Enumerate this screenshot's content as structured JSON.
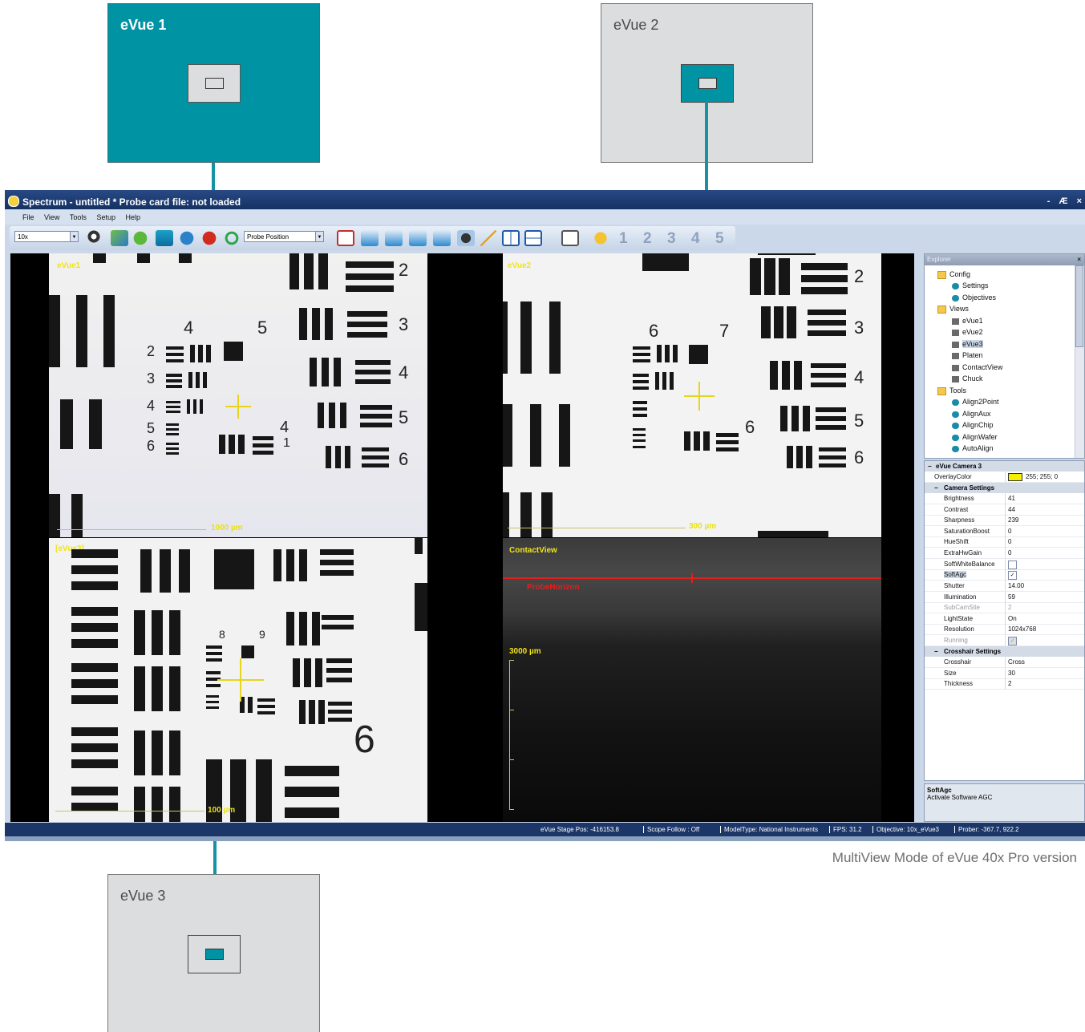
{
  "callouts": {
    "evue1": "eVue 1",
    "evue2": "eVue 2",
    "evue3": "eVue 3"
  },
  "caption": "MultiView Mode of eVue 40x Pro version",
  "app": {
    "title": "Spectrum - untitled *  Probe card file: not loaded",
    "window_controls": [
      "-",
      "Æ",
      "×"
    ],
    "menu": [
      "File",
      "View",
      "Tools",
      "Setup",
      "Help"
    ],
    "toolbar": {
      "objective": "10x",
      "probe_position": "Probe Position",
      "numbered_tools": [
        "1",
        "2",
        "3",
        "4",
        "5"
      ]
    },
    "views": {
      "view1": {
        "label": "eVue1",
        "scale": "1000 µm",
        "numbers": [
          "2",
          "3",
          "4",
          "5",
          "6",
          "2",
          "3",
          "4",
          "5",
          "6",
          "4",
          "5",
          "4",
          "1"
        ]
      },
      "view2": {
        "label": "eVue2",
        "scale": "300 µm",
        "numbers": [
          "2",
          "3",
          "4",
          "5",
          "6",
          "6",
          "7",
          "6"
        ]
      },
      "view3": {
        "label": "[eVue3]",
        "scale": "100 µm",
        "numbers": [
          "6",
          "8",
          "9"
        ]
      },
      "contact": {
        "label": "ContactView",
        "horizon": "ProbeHorizon",
        "scale": "3000 µm"
      }
    },
    "explorer": {
      "title": "Explorer",
      "items": [
        {
          "label": "Config",
          "icon": "folder-icon"
        },
        {
          "label": "Settings",
          "icon": "ball-icon"
        },
        {
          "label": "Objectives",
          "icon": "ball-icon"
        },
        {
          "label": "Views",
          "icon": "folder-icon"
        },
        {
          "label": "eVue1",
          "icon": "camera-icon"
        },
        {
          "label": "eVue2",
          "icon": "camera-icon"
        },
        {
          "label": "eVue3",
          "icon": "camera-icon"
        },
        {
          "label": "Platen",
          "icon": "camera-icon"
        },
        {
          "label": "ContactView",
          "icon": "camera-icon"
        },
        {
          "label": "Chuck",
          "icon": "camera-icon"
        },
        {
          "label": "Tools",
          "icon": "folder-icon"
        },
        {
          "label": "Align2Point",
          "icon": "ball-icon"
        },
        {
          "label": "AlignAux",
          "icon": "ball-icon"
        },
        {
          "label": "AlignChip",
          "icon": "ball-icon"
        },
        {
          "label": "AlignWafer",
          "icon": "ball-icon"
        },
        {
          "label": "AutoAlign",
          "icon": "ball-icon"
        }
      ]
    },
    "properties": {
      "section": "eVue Camera 3",
      "overlay_name": "OverlayColor",
      "overlay_value": "255; 255; 0",
      "camera_settings": "Camera Settings",
      "rows": [
        {
          "name": "Brightness",
          "value": "41"
        },
        {
          "name": "Contrast",
          "value": "44"
        },
        {
          "name": "Sharpness",
          "value": "239"
        },
        {
          "name": "SaturationBoost",
          "value": "0"
        },
        {
          "name": "HueShift",
          "value": "0"
        },
        {
          "name": "ExtraHwGain",
          "value": "0"
        },
        {
          "name": "SoftWhiteBalance",
          "value": ""
        },
        {
          "name": "SoftAgc",
          "value": "✓"
        },
        {
          "name": "Shutter",
          "value": "14.00"
        },
        {
          "name": "Illumination",
          "value": "59"
        },
        {
          "name": "SubCamSite",
          "value": "2"
        },
        {
          "name": "LightState",
          "value": "On"
        },
        {
          "name": "Resolution",
          "value": "1024x768"
        },
        {
          "name": "Running",
          "value": "✓"
        }
      ],
      "crosshair_settings": "Crosshair Settings",
      "crosshair_rows": [
        {
          "name": "Crosshair",
          "value": "Cross"
        },
        {
          "name": "Size",
          "value": "30"
        },
        {
          "name": "Thickness",
          "value": "2"
        }
      ],
      "desc_title": "SoftAgc",
      "desc_text": "Activate Software AGC"
    },
    "status": {
      "stage": "eVue Stage Pos: -416153.8",
      "scope": "Scope Follow : Off",
      "model": "ModelType: National Instruments",
      "fps": "FPS: 31.2",
      "objective": "Objective: 10x_eVue3",
      "prober": "Prober:  -367.7,  922.2"
    }
  },
  "colors": {
    "accent": "#0093a3",
    "crosshair": "#f1e31a",
    "horizon": "#e0201c",
    "titlebar": "#1c3668"
  }
}
